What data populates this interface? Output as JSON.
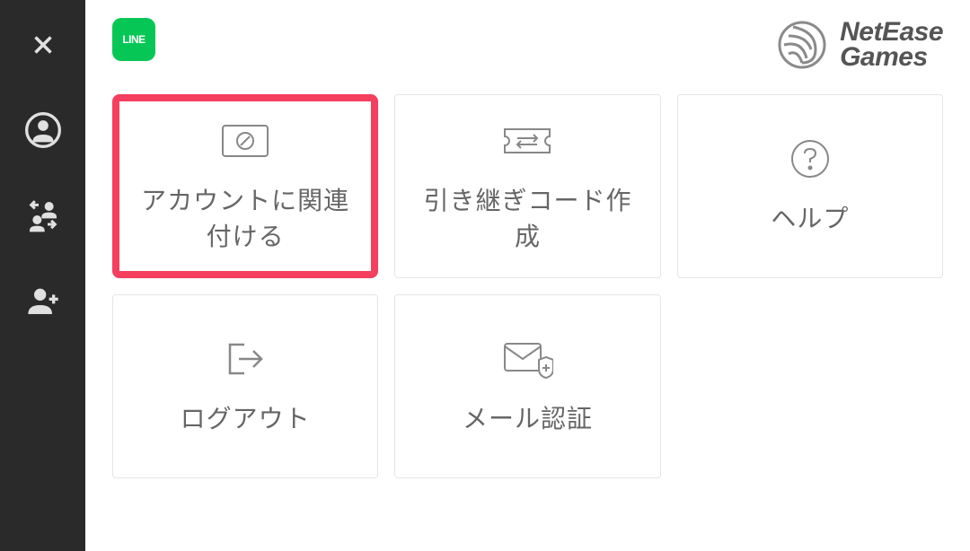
{
  "brand": {
    "line1": "NetEase",
    "line2": "Games"
  },
  "line_icon_label": "LINE",
  "tiles": {
    "link_account": "アカウントに関連\n付ける",
    "transfer_code": "引き継ぎコード作\n成",
    "help": "ヘルプ",
    "logout": "ログアウト",
    "mail_auth": "メール認証"
  },
  "colors": {
    "highlight": "#F43F5E",
    "line_green": "#06C755"
  }
}
